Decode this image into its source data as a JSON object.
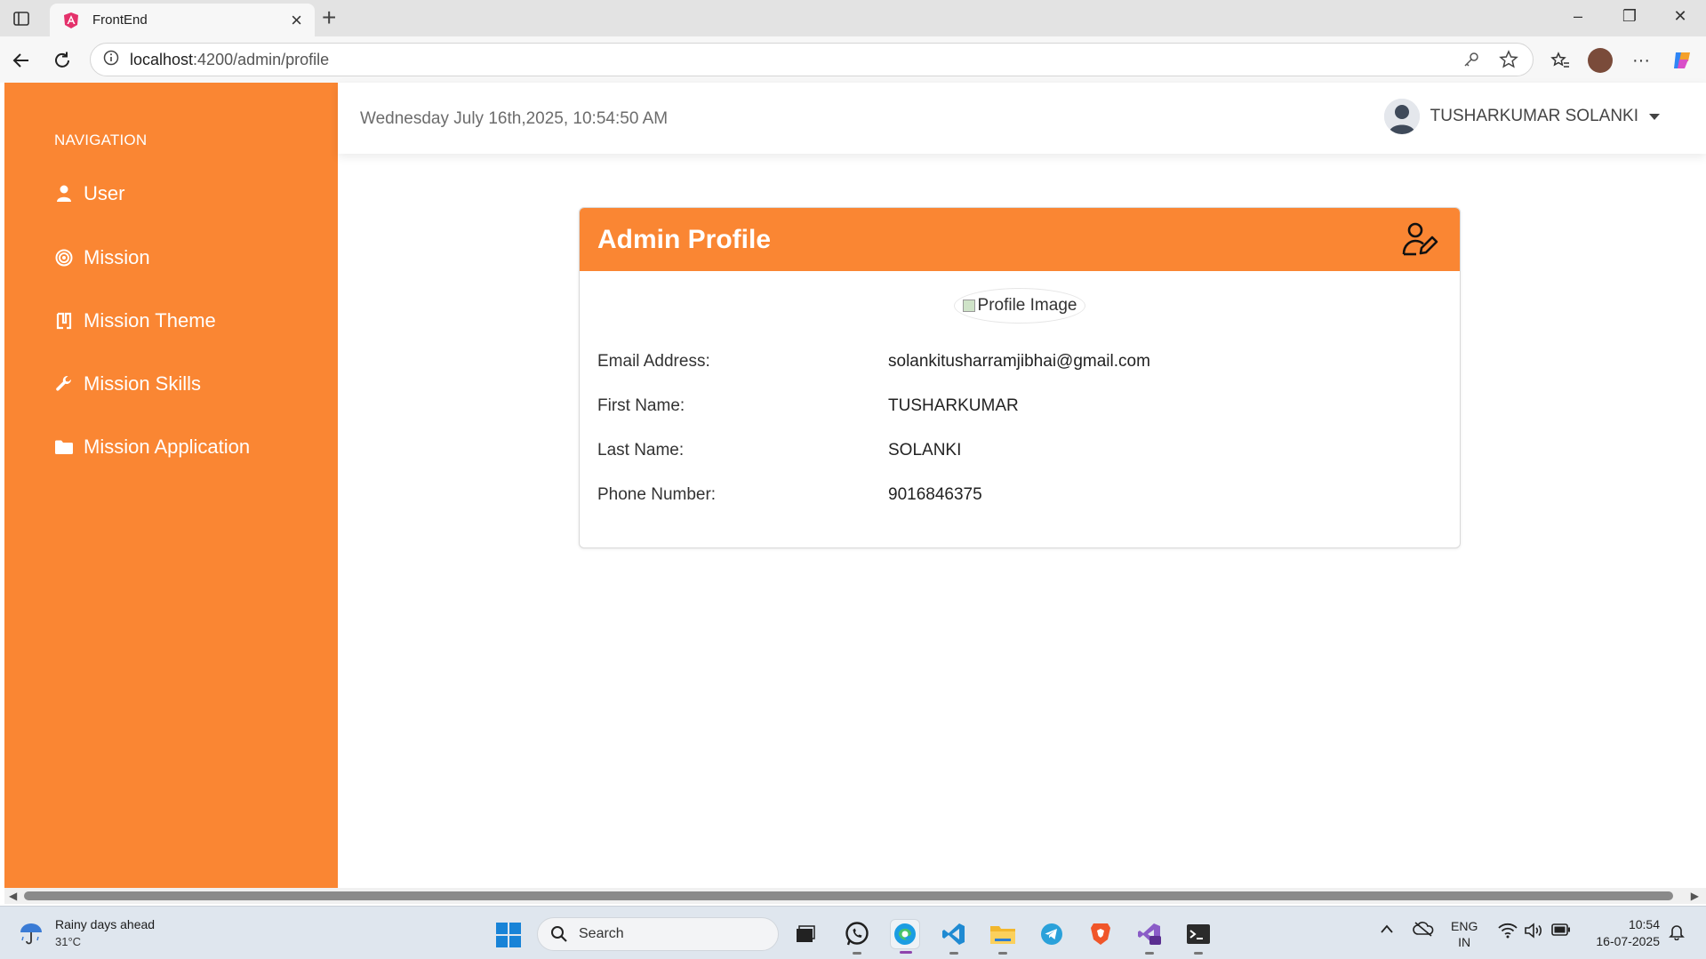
{
  "browser": {
    "tab_title": "FrontEnd",
    "url_host": "localhost",
    "url_path": ":4200/admin/profile"
  },
  "sidebar": {
    "heading": "NAVIGATION",
    "items": [
      {
        "label": "User",
        "icon": "user-icon"
      },
      {
        "label": "Mission",
        "icon": "target-icon"
      },
      {
        "label": "Mission Theme",
        "icon": "theme-icon"
      },
      {
        "label": "Mission Skills",
        "icon": "wrench-icon"
      },
      {
        "label": "Mission Application",
        "icon": "folder-icon"
      }
    ]
  },
  "header": {
    "datetime": "Wednesday July 16th,2025, 10:54:50 AM",
    "user_name": "TUSHARKUMAR SOLANKI"
  },
  "profile": {
    "title": "Admin Profile",
    "image_alt": "Profile Image",
    "fields": [
      {
        "label": "Email Address:",
        "value": "solankitusharramjibhai@gmail.com"
      },
      {
        "label": "First Name:",
        "value": "TUSHARKUMAR"
      },
      {
        "label": "Last Name:",
        "value": "SOLANKI"
      },
      {
        "label": "Phone Number:",
        "value": "9016846375"
      }
    ]
  },
  "taskbar": {
    "weather_title": "Rainy days ahead",
    "weather_temp": "31°C",
    "search_placeholder": "Search",
    "lang_line1": "ENG",
    "lang_line2": "IN",
    "time": "10:54",
    "date": "16-07-2025"
  },
  "colors": {
    "accent": "#fa8633"
  }
}
